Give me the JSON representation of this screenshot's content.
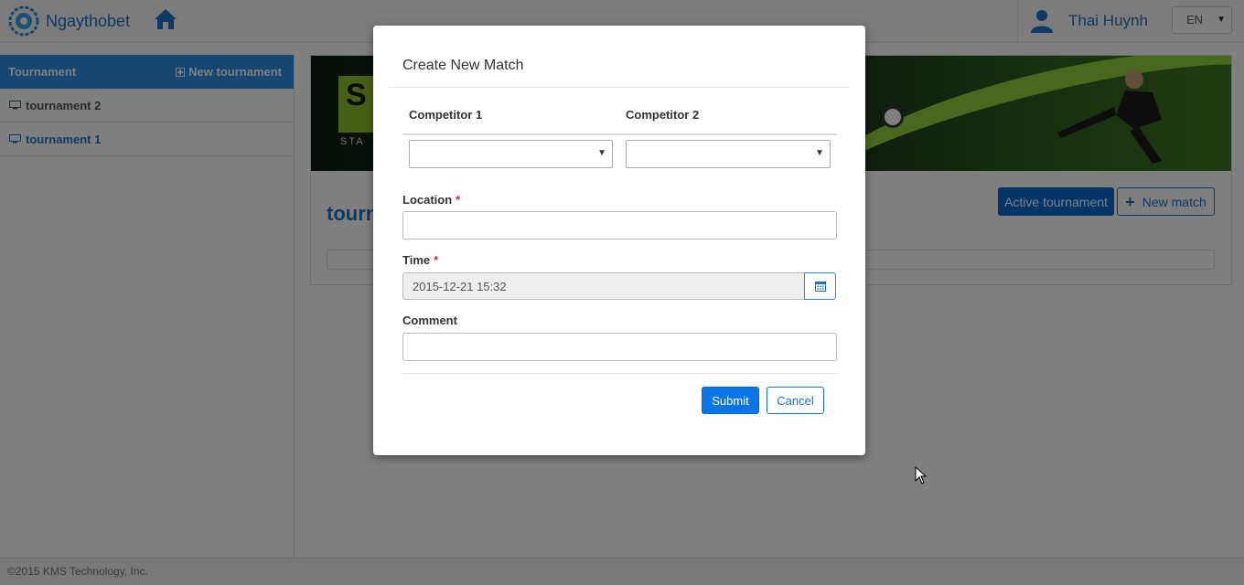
{
  "app": {
    "brand_name": "Ngaythobet",
    "user_name": "Thai Huynh",
    "language": "EN"
  },
  "sidebar": {
    "header_title": "Tournament",
    "new_tournament_label": "New tournament",
    "items": [
      {
        "label": "tournament 2",
        "active": false
      },
      {
        "label": "tournament 1",
        "active": true
      }
    ]
  },
  "main": {
    "banner_text": {
      "letter": "S",
      "start": "STA"
    },
    "heading": "tourn",
    "active_tournament_label": "Active tournament",
    "new_match_label": "New match"
  },
  "modal": {
    "title": "Create New Match",
    "competitor1_label": "Competitor 1",
    "competitor2_label": "Competitor 2",
    "competitor1_value": "",
    "competitor2_value": "",
    "location_label": "Location",
    "location_value": "",
    "time_label": "Time",
    "time_value": "2015-12-21 15:32",
    "comment_label": "Comment",
    "comment_value": "",
    "required_marker": "*",
    "submit_label": "Submit",
    "cancel_label": "Cancel"
  },
  "footer": {
    "copyright": "©2015 KMS Technology, Inc."
  },
  "colors": {
    "accent": "#1a73c8",
    "sidebar_header": "#2e8ce6",
    "primary_button": "#0a75e6",
    "required": "#c9302c"
  },
  "icons": [
    "logo-icon",
    "home-icon",
    "user-icon",
    "chevron-down-icon",
    "monitor-icon",
    "plus-square-icon",
    "plus-icon",
    "calendar-icon",
    "mouse-cursor-icon"
  ]
}
